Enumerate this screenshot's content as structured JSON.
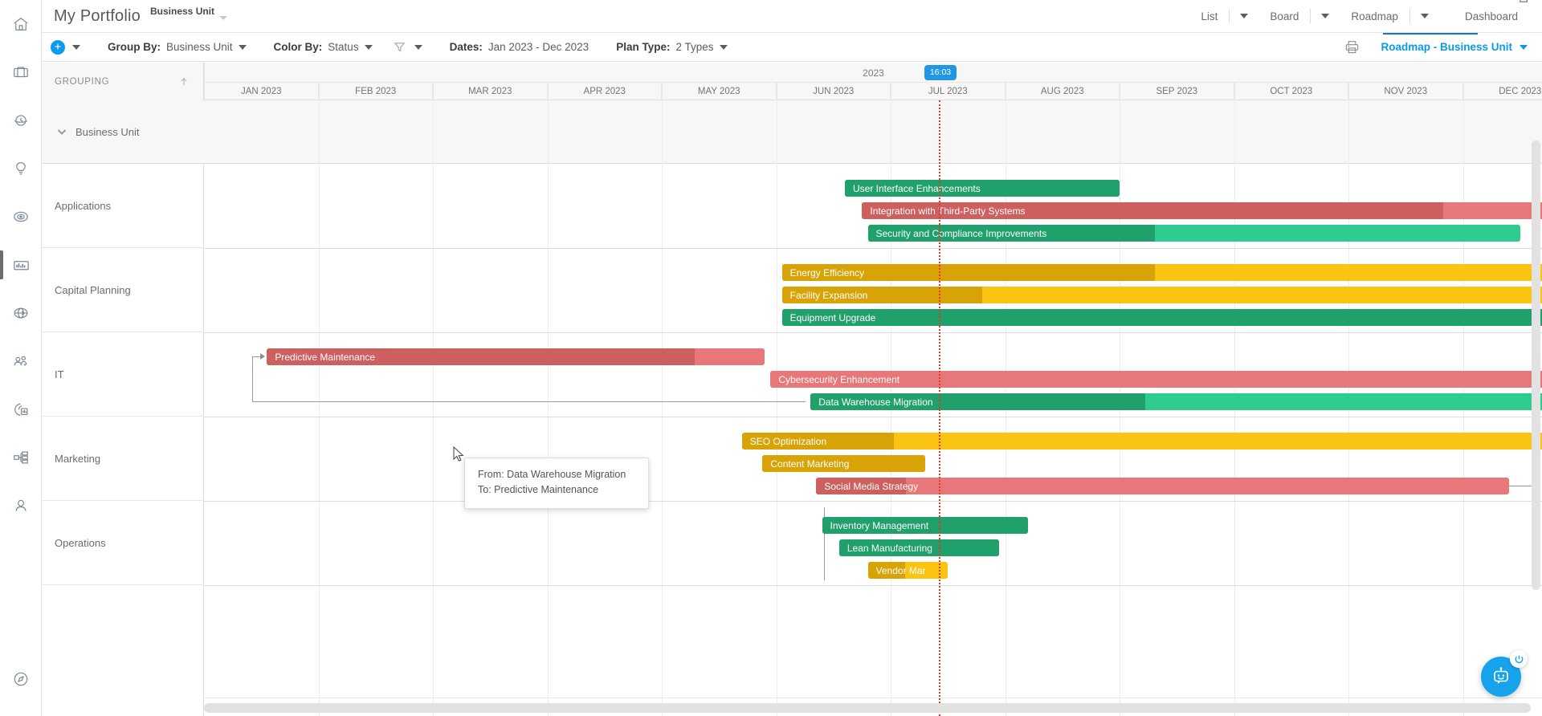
{
  "app": {
    "portfolio_title": "My Portfolio",
    "portfolio_subtitle": "Business Unit"
  },
  "view_tabs": [
    {
      "label": "List"
    },
    {
      "label": "Board"
    },
    {
      "label": "Roadmap"
    },
    {
      "label": "Dashboard"
    }
  ],
  "toolbar": {
    "group_by_label": "Group By:",
    "group_by_value": "Business Unit",
    "color_by_label": "Color By:",
    "color_by_value": "Status",
    "dates_label": "Dates:",
    "dates_value": "Jan 2023 - Dec 2023",
    "plan_type_label": "Plan Type:",
    "plan_type_value": "2 Types",
    "report_link": "Roadmap - Business Unit",
    "print_icon": "printer-icon",
    "filter_icon": "funnel-icon",
    "add_icon": "plus-icon"
  },
  "grid": {
    "grouping_header": "GROUPING",
    "year_label": "2023",
    "now_badge": "16:03",
    "months": [
      "JAN 2023",
      "FEB 2023",
      "MAR 2023",
      "APR 2023",
      "MAY 2023",
      "JUN 2023",
      "JUL 2023",
      "AUG 2023",
      "SEP 2023",
      "OCT 2023",
      "NOV 2023",
      "DEC 2023"
    ],
    "group_header": "Business Unit",
    "rows": [
      {
        "label": "Applications"
      },
      {
        "label": "Capital Planning"
      },
      {
        "label": "IT"
      },
      {
        "label": "Marketing"
      },
      {
        "label": "Operations"
      }
    ]
  },
  "colors": {
    "accent": "#0b9ae8",
    "green": "#2ecc8f",
    "green_fill": "#20a06a",
    "red": "#e8777a",
    "red_fill": "#cd5f5f",
    "amber": "#fbc312",
    "amber_fill": "#d7a307",
    "today_line": "#e8342a",
    "now_badge_bg": "#2196e3"
  },
  "chart_data": {
    "type": "bar",
    "title": "Roadmap - Business Unit",
    "xlabel": "",
    "ylabel": "",
    "axis_range": [
      "Jan 2023",
      "Dec 2023"
    ],
    "today_marker": "16:03",
    "groups": [
      {
        "group": "Applications",
        "bars": [
          {
            "label": "User Interface Enhancements",
            "color": "green",
            "start_month": 5.6,
            "end_month": 8.0,
            "progress": 1.0
          },
          {
            "label": "Integration with Third-Party Systems",
            "color": "red",
            "start_month": 5.75,
            "end_month": 13.0,
            "progress": 0.7
          },
          {
            "label": "Security and Compliance Improvements",
            "color": "green",
            "start_month": 5.8,
            "end_month": 11.5,
            "progress": 0.44
          }
        ]
      },
      {
        "group": "Capital Planning",
        "bars": [
          {
            "label": "Energy Efficiency",
            "color": "amber",
            "start_month": 5.05,
            "end_month": 13.0,
            "progress": 0.41
          },
          {
            "label": "Facility Expansion",
            "color": "amber",
            "start_month": 5.05,
            "end_month": 13.0,
            "progress": 0.22
          },
          {
            "label": "Equipment Upgrade",
            "color": "green",
            "start_month": 5.05,
            "end_month": 13.0,
            "progress": 1.0
          }
        ]
      },
      {
        "group": "IT",
        "bars": [
          {
            "label": "Predictive Maintenance",
            "color": "red",
            "start_month": 0.55,
            "end_month": 4.9,
            "progress": 0.86
          },
          {
            "label": "Cybersecurity Enhancement",
            "color": "red",
            "start_month": 4.95,
            "end_month": 11.9,
            "progress": 0.0
          },
          {
            "label": "Data Warehouse Migration",
            "color": "green",
            "start_month": 5.3,
            "end_month": 13.0,
            "progress": 0.38
          }
        ]
      },
      {
        "group": "Marketing",
        "bars": [
          {
            "label": "SEO Optimization",
            "color": "amber",
            "start_month": 4.7,
            "end_month": 13.0,
            "progress": 0.16
          },
          {
            "label": "Content Marketing",
            "color": "amber",
            "start_month": 4.88,
            "end_month": 6.3,
            "progress": 1.0
          },
          {
            "label": "Social Media Strategy",
            "color": "red",
            "start_month": 5.35,
            "end_month": 11.4,
            "progress": 0.13
          }
        ]
      },
      {
        "group": "Operations",
        "bars": [
          {
            "label": "Inventory Management",
            "color": "green",
            "start_month": 5.4,
            "end_month": 7.2,
            "progress": 1.0
          },
          {
            "label": "Lean Manufacturing",
            "color": "green",
            "start_month": 5.55,
            "end_month": 6.95,
            "progress": 1.0
          },
          {
            "label": "Vendor Mar",
            "color": "amber",
            "start_month": 5.8,
            "end_month": 6.5,
            "progress": 0.47
          }
        ]
      }
    ]
  },
  "tooltip": {
    "from_line": "From: Data Warehouse Migration",
    "to_line": "To: Predictive Maintenance"
  },
  "sidebar": {
    "items": [
      {
        "name": "home-icon",
        "label": "Home"
      },
      {
        "name": "briefcase-icon",
        "label": "Portfolio"
      },
      {
        "name": "clock-icon",
        "label": "Timesheets"
      },
      {
        "name": "lightbulb-icon",
        "label": "Ideas"
      },
      {
        "name": "target-icon",
        "label": "Goals"
      },
      {
        "name": "bar-chart-icon",
        "label": "Roadmaps"
      },
      {
        "name": "globe-icon",
        "label": "Global"
      },
      {
        "name": "people-icon",
        "label": "Resources"
      },
      {
        "name": "reports-icon",
        "label": "Reports"
      },
      {
        "name": "hierarchy-icon",
        "label": "Structure"
      },
      {
        "name": "person-icon",
        "label": "Profile"
      }
    ],
    "bottom": {
      "name": "compass-icon",
      "label": "Help"
    }
  },
  "fab": {
    "chat_icon": "chatbot-icon",
    "power_icon": "power-icon"
  }
}
